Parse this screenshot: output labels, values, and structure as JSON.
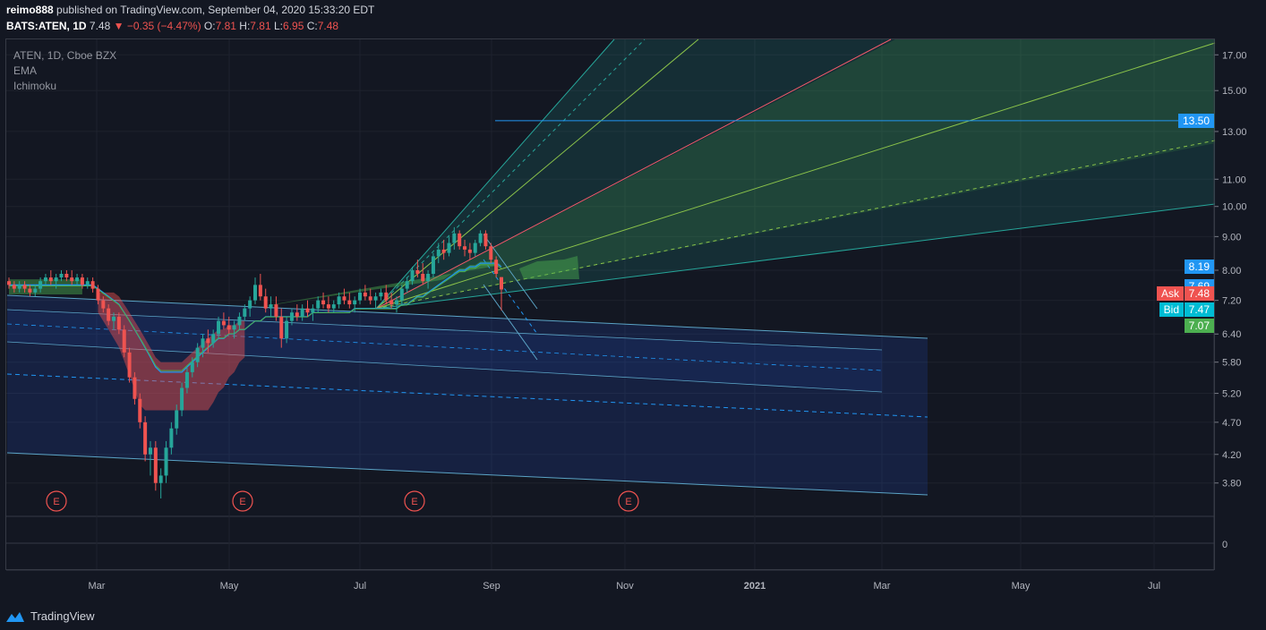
{
  "header": {
    "user": "reimo888",
    "published_text": "published on TradingView.com, September 04, 2020 15:33:20 EDT",
    "symbol": "BATS:ATEN, 1D",
    "last": "7.48",
    "change": "−0.35 (−4.47%)",
    "o_label": "O:",
    "o": "7.81",
    "h_label": "H:",
    "h": "7.81",
    "l_label": "L:",
    "l": "6.95",
    "c_label": "C:",
    "c": "7.48"
  },
  "legend": {
    "title": "ATEN, 1D, Cboe BZX",
    "ind1": "EMA",
    "ind2": "Ichimoku"
  },
  "price_tags": {
    "level": "13.50",
    "p819": "8.19",
    "p769": "7.69",
    "ask_label": "Ask",
    "ask": "7.48",
    "bid_label": "Bid",
    "bid": "7.47",
    "p707": "7.07"
  },
  "earnings_marker": "E",
  "footer": {
    "brand": "TradingView"
  },
  "colors": {
    "background": "#131722",
    "up": "#26a69a",
    "down": "#ef5350",
    "level": "#2196f3",
    "ask": "#ef5350",
    "bid": "#00bcd4",
    "p707": "#4caf50"
  },
  "chart_data": {
    "type": "candlestick",
    "y_axis": {
      "scale": "log",
      "ylim": [
        3.6,
        17.5
      ],
      "ticks": [
        17.0,
        15.0,
        13.0,
        11.0,
        10.0,
        9.0,
        8.0,
        7.2,
        6.4,
        5.8,
        5.2,
        4.7,
        4.2,
        3.8
      ],
      "tick_labels": [
        "17.00",
        "15.00",
        "13.00",
        "11.00",
        "10.00",
        "9.00",
        "8.00",
        "7.20",
        "6.40",
        "5.80",
        "5.20",
        "4.70",
        "4.20",
        "3.80"
      ]
    },
    "x_axis": {
      "ticks": [
        "Mar",
        "May",
        "Jul",
        "Sep",
        "Nov",
        "2021",
        "Mar",
        "May",
        "Jul"
      ]
    },
    "volume_pane": {
      "tick_labels": [
        "0"
      ]
    },
    "candles": [
      [
        7.7,
        7.8,
        7.5,
        7.6
      ],
      [
        7.6,
        7.7,
        7.4,
        7.5
      ],
      [
        7.5,
        7.7,
        7.4,
        7.6
      ],
      [
        7.6,
        7.7,
        7.4,
        7.5
      ],
      [
        7.5,
        7.6,
        7.3,
        7.4
      ],
      [
        7.4,
        7.6,
        7.3,
        7.5
      ],
      [
        7.5,
        7.8,
        7.4,
        7.7
      ],
      [
        7.7,
        7.9,
        7.6,
        7.8
      ],
      [
        7.8,
        8.0,
        7.6,
        7.7
      ],
      [
        7.7,
        7.9,
        7.5,
        7.8
      ],
      [
        7.8,
        8.0,
        7.7,
        7.9
      ],
      [
        7.9,
        8.0,
        7.7,
        7.8
      ],
      [
        7.8,
        8.0,
        7.6,
        7.7
      ],
      [
        7.7,
        7.9,
        7.6,
        7.8
      ],
      [
        7.8,
        7.9,
        7.5,
        7.6
      ],
      [
        7.6,
        7.8,
        7.5,
        7.7
      ],
      [
        7.7,
        7.8,
        7.4,
        7.5
      ],
      [
        7.5,
        7.6,
        7.1,
        7.2
      ],
      [
        7.2,
        7.3,
        6.9,
        7.0
      ],
      [
        7.0,
        7.1,
        6.6,
        6.7
      ],
      [
        6.7,
        6.9,
        6.5,
        6.8
      ],
      [
        6.8,
        6.9,
        6.4,
        6.5
      ],
      [
        6.5,
        6.6,
        5.9,
        6.0
      ],
      [
        6.0,
        6.1,
        5.4,
        5.5
      ],
      [
        5.5,
        5.6,
        5.0,
        5.1
      ],
      [
        5.1,
        5.2,
        4.6,
        4.7
      ],
      [
        4.7,
        4.8,
        4.1,
        4.2
      ],
      [
        4.2,
        4.4,
        3.9,
        4.3
      ],
      [
        4.3,
        4.4,
        3.7,
        3.8
      ],
      [
        3.8,
        4.0,
        3.6,
        3.9
      ],
      [
        3.9,
        4.4,
        3.8,
        4.3
      ],
      [
        4.3,
        4.7,
        4.2,
        4.6
      ],
      [
        4.6,
        5.0,
        4.5,
        4.9
      ],
      [
        4.9,
        5.4,
        4.8,
        5.3
      ],
      [
        5.3,
        5.7,
        5.2,
        5.6
      ],
      [
        5.6,
        5.9,
        5.5,
        5.8
      ],
      [
        5.8,
        6.2,
        5.7,
        6.1
      ],
      [
        6.1,
        6.4,
        5.9,
        6.3
      ],
      [
        6.3,
        6.5,
        6.0,
        6.2
      ],
      [
        6.2,
        6.5,
        6.1,
        6.4
      ],
      [
        6.4,
        6.8,
        6.3,
        6.7
      ],
      [
        6.7,
        6.9,
        6.5,
        6.6
      ],
      [
        6.6,
        6.8,
        6.4,
        6.5
      ],
      [
        6.5,
        6.7,
        6.3,
        6.6
      ],
      [
        6.6,
        6.9,
        6.5,
        6.8
      ],
      [
        6.8,
        7.1,
        6.7,
        7.0
      ],
      [
        7.0,
        7.3,
        6.8,
        7.2
      ],
      [
        7.2,
        7.8,
        7.1,
        7.6
      ],
      [
        7.6,
        7.9,
        7.2,
        7.3
      ],
      [
        7.3,
        7.5,
        6.9,
        7.0
      ],
      [
        7.0,
        7.3,
        6.8,
        7.1
      ],
      [
        7.1,
        7.3,
        6.7,
        6.8
      ],
      [
        6.8,
        7.0,
        6.1,
        6.3
      ],
      [
        6.3,
        6.8,
        6.2,
        6.7
      ],
      [
        6.7,
        7.0,
        6.6,
        6.9
      ],
      [
        6.9,
        7.1,
        6.7,
        6.8
      ],
      [
        6.8,
        7.1,
        6.7,
        7.0
      ],
      [
        7.0,
        7.2,
        6.8,
        6.9
      ],
      [
        6.9,
        7.1,
        6.7,
        7.0
      ],
      [
        7.0,
        7.3,
        6.9,
        7.2
      ],
      [
        7.2,
        7.4,
        7.0,
        7.1
      ],
      [
        7.1,
        7.3,
        6.9,
        7.0
      ],
      [
        7.0,
        7.2,
        6.9,
        7.1
      ],
      [
        7.1,
        7.4,
        7.0,
        7.3
      ],
      [
        7.3,
        7.5,
        7.1,
        7.2
      ],
      [
        7.2,
        7.4,
        7.0,
        7.1
      ],
      [
        7.1,
        7.3,
        6.9,
        7.2
      ],
      [
        7.2,
        7.5,
        7.1,
        7.4
      ],
      [
        7.4,
        7.6,
        7.2,
        7.3
      ],
      [
        7.3,
        7.5,
        7.1,
        7.2
      ],
      [
        7.2,
        7.4,
        7.0,
        7.3
      ],
      [
        7.3,
        7.5,
        7.2,
        7.4
      ],
      [
        7.4,
        7.6,
        7.1,
        7.2
      ],
      [
        7.2,
        7.4,
        7.0,
        7.1
      ],
      [
        7.1,
        7.3,
        6.9,
        7.2
      ],
      [
        7.2,
        7.6,
        7.1,
        7.5
      ],
      [
        7.5,
        7.8,
        7.4,
        7.7
      ],
      [
        7.7,
        8.1,
        7.6,
        8.0
      ],
      [
        8.0,
        8.3,
        7.8,
        7.9
      ],
      [
        7.9,
        8.2,
        7.6,
        7.7
      ],
      [
        7.7,
        8.0,
        7.5,
        7.9
      ],
      [
        7.9,
        8.5,
        7.8,
        8.4
      ],
      [
        8.4,
        8.8,
        8.2,
        8.6
      ],
      [
        8.6,
        8.9,
        8.3,
        8.5
      ],
      [
        8.5,
        9.0,
        8.4,
        8.8
      ],
      [
        8.8,
        9.3,
        8.6,
        9.1
      ],
      [
        9.1,
        9.2,
        8.6,
        8.7
      ],
      [
        8.7,
        8.9,
        8.4,
        8.6
      ],
      [
        8.6,
        8.8,
        8.3,
        8.5
      ],
      [
        8.5,
        8.9,
        8.4,
        8.8
      ],
      [
        8.8,
        9.2,
        8.7,
        9.1
      ],
      [
        9.1,
        9.2,
        8.6,
        8.7
      ],
      [
        8.7,
        8.8,
        8.2,
        8.3
      ],
      [
        8.3,
        8.4,
        7.8,
        7.9
      ],
      [
        7.81,
        7.81,
        6.95,
        7.48
      ]
    ],
    "ema": [
      7.6,
      7.6,
      7.6,
      7.6,
      7.6,
      7.6,
      7.6,
      7.6,
      7.6,
      7.6,
      7.6,
      7.6,
      7.6,
      7.6,
      7.6,
      7.6,
      7.6,
      7.5,
      7.4,
      7.3,
      7.2,
      7.1,
      6.9,
      6.7,
      6.5,
      6.3,
      6.1,
      5.9,
      5.7,
      5.6,
      5.6,
      5.6,
      5.6,
      5.6,
      5.7,
      5.8,
      5.9,
      6.0,
      6.1,
      6.2,
      6.3,
      6.3,
      6.4,
      6.4,
      6.5,
      6.5,
      6.6,
      6.7,
      6.7,
      6.8,
      6.8,
      6.8,
      6.8,
      6.8,
      6.8,
      6.8,
      6.8,
      6.8,
      6.9,
      6.9,
      6.9,
      6.9,
      6.9,
      6.9,
      6.9,
      6.9,
      7.0,
      7.0,
      7.0,
      7.0,
      7.0,
      7.0,
      7.0,
      7.0,
      7.0,
      7.1,
      7.1,
      7.2,
      7.3,
      7.3,
      7.4,
      7.5,
      7.6,
      7.7,
      7.8,
      7.9,
      8.0,
      8.0,
      8.1,
      8.1,
      8.2,
      8.2,
      8.2,
      8.2,
      8.1
    ],
    "levels": {
      "horizontal": 13.5
    },
    "earnings_markers": 4
  }
}
